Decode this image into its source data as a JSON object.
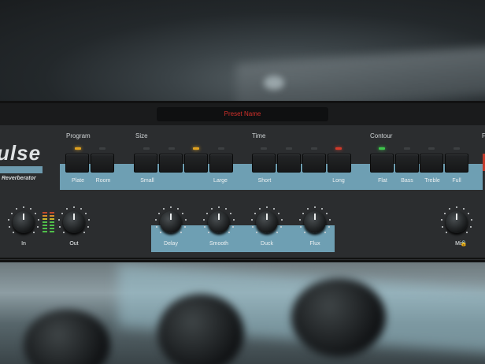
{
  "preset": {
    "name": "Preset Name"
  },
  "logo": {
    "text": "ulse",
    "subtitle": "Reverberator"
  },
  "sections": {
    "program": {
      "title": "Program",
      "labels": [
        "Plate",
        "Room"
      ]
    },
    "size": {
      "title": "Size",
      "labels": [
        "Small",
        "Large"
      ]
    },
    "time": {
      "title": "Time",
      "labels": [
        "Short",
        "Long"
      ]
    },
    "contour": {
      "title": "Contour",
      "labels": [
        "Flat",
        "Bass",
        "Treble",
        "Full"
      ]
    },
    "cutoff": {
      "title": "F"
    }
  },
  "knobs": {
    "in": "In",
    "out": "Out",
    "delay": "Delay",
    "smooth": "Smooth",
    "duck": "Duck",
    "flux": "Flux",
    "mix": "Mix",
    "mix_lock": "🔒"
  },
  "colors": {
    "accent_blue": "#6e9fb3",
    "preset_text": "#d2302a",
    "led_amber": "#e0a220",
    "led_red": "#d33a2a",
    "led_green": "#3ec64c"
  }
}
